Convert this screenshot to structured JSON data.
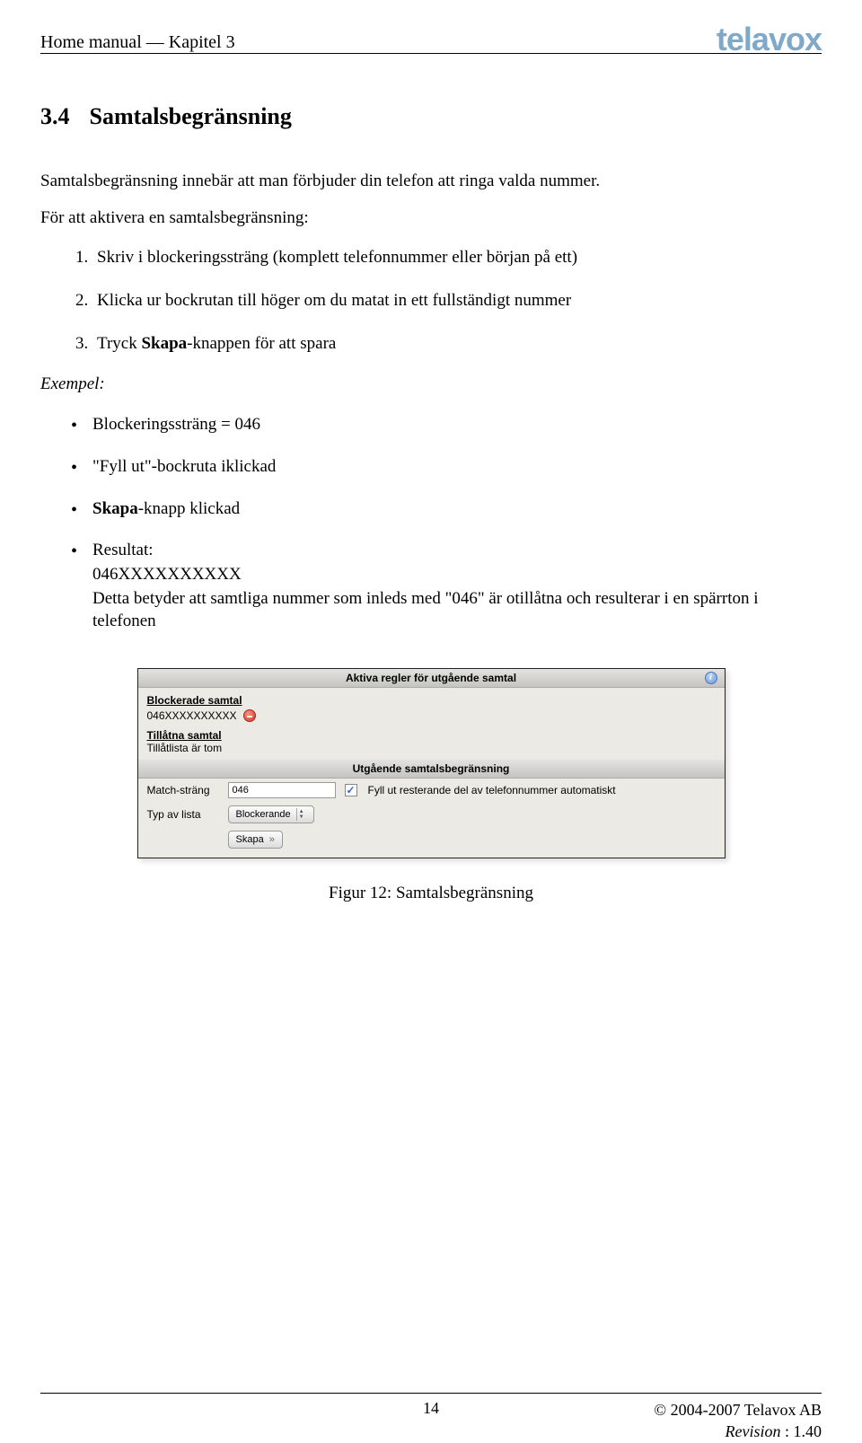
{
  "header": {
    "doc_title": "Home manual — Kapitel 3",
    "logo_text": "telavox"
  },
  "section": {
    "number": "3.4",
    "title": "Samtalsbegränsning"
  },
  "p_intro": "Samtalsbegränsning innebär att man förbjuder din telefon att ringa valda nummer.",
  "p_activate": "För att aktivera en samtalsbegränsning:",
  "steps": {
    "s1": "Skriv i blockeringssträng (komplett telefonnummer eller början på ett)",
    "s2": "Klicka ur bockrutan till höger om du matat in ett fullständigt nummer",
    "s3_pre": "Tryck ",
    "s3_b": "Skapa",
    "s3_post": "-knappen för att spara"
  },
  "exempel_label": "Exempel:",
  "bullets": {
    "b1": "Blockeringssträng = 046",
    "b2": "\"Fyll ut\"-bockruta iklickad",
    "b3_b": "Skapa",
    "b3_post": "-knapp klickad",
    "b4_title": "Resultat:",
    "b4_l1": "046XXXXXXXXXX",
    "b4_l2": "Detta betyder att samtliga nummer som inleds med \"046\" är otillåtna och resulterar i en spärrton i telefonen"
  },
  "screenshot": {
    "bar1": "Aktiva regler för utgående samtal",
    "h_blocked": "Blockerade samtal",
    "blocked_value": "046XXXXXXXXXX",
    "h_allowed": "Tillåtna samtal",
    "allowed_value": "Tillåtlista är tom",
    "bar2": "Utgående samtalsbegränsning",
    "lbl_match": "Match-sträng",
    "field_match": "046",
    "chk_label": "Fyll ut resterande del av telefonnummer automatiskt",
    "lbl_type": "Typ av lista",
    "sel_type": "Blockerande",
    "btn_create": "Skapa"
  },
  "caption": "Figur 12: Samtalsbegränsning",
  "footer": {
    "page": "14",
    "copyright": "© 2004-2007 Telavox AB",
    "rev_label": "Revision",
    "rev_sep": " : ",
    "rev_val": "1.40"
  }
}
